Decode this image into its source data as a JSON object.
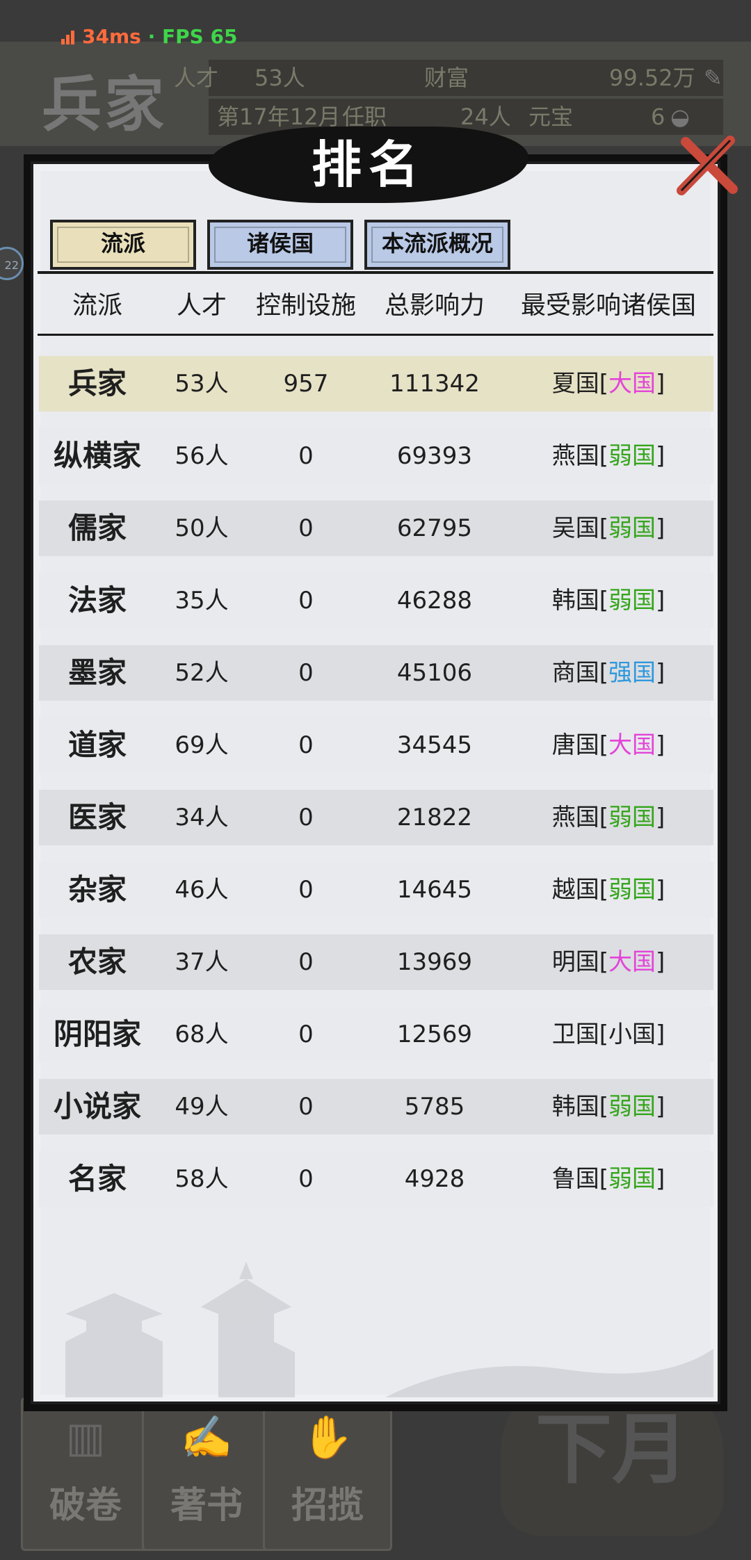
{
  "status": {
    "latency": "34ms",
    "separator": "·",
    "fps": "FPS 65"
  },
  "background": {
    "section_title": "兵家",
    "stats": {
      "talent_label": "人才",
      "talent_value": "53人",
      "wealth_label": "财富",
      "wealth_value": "99.52万",
      "date": "第17年12月",
      "office_label": "任职",
      "office_value": "24人",
      "ingot_label": "元宝",
      "ingot_value": "6"
    },
    "side_badge": "22",
    "bottom_buttons": [
      "破卷",
      "著书",
      "招揽"
    ],
    "next_month": "下月"
  },
  "modal": {
    "title": "排名",
    "tabs": [
      "流派",
      "诸侯国",
      "本流派概况"
    ],
    "columns": [
      "流派",
      "人才",
      "控制设施",
      "总影响力",
      "最受影响诸侯国"
    ],
    "rows": [
      {
        "school": "兵家",
        "talent": "53人",
        "control": "957",
        "influence": "111342",
        "state": "夏国",
        "tier": "大国",
        "tier_class": "tier-big"
      },
      {
        "school": "纵横家",
        "talent": "56人",
        "control": "0",
        "influence": "69393",
        "state": "燕国",
        "tier": "弱国",
        "tier_class": "tier-weak"
      },
      {
        "school": "儒家",
        "talent": "50人",
        "control": "0",
        "influence": "62795",
        "state": "吴国",
        "tier": "弱国",
        "tier_class": "tier-weak"
      },
      {
        "school": "法家",
        "talent": "35人",
        "control": "0",
        "influence": "46288",
        "state": "韩国",
        "tier": "弱国",
        "tier_class": "tier-weak"
      },
      {
        "school": "墨家",
        "talent": "52人",
        "control": "0",
        "influence": "45106",
        "state": "商国",
        "tier": "强国",
        "tier_class": "tier-strong"
      },
      {
        "school": "道家",
        "talent": "69人",
        "control": "0",
        "influence": "34545",
        "state": "唐国",
        "tier": "大国",
        "tier_class": "tier-big"
      },
      {
        "school": "医家",
        "talent": "34人",
        "control": "0",
        "influence": "21822",
        "state": "燕国",
        "tier": "弱国",
        "tier_class": "tier-weak"
      },
      {
        "school": "杂家",
        "talent": "46人",
        "control": "0",
        "influence": "14645",
        "state": "越国",
        "tier": "弱国",
        "tier_class": "tier-weak"
      },
      {
        "school": "农家",
        "talent": "37人",
        "control": "0",
        "influence": "13969",
        "state": "明国",
        "tier": "大国",
        "tier_class": "tier-big"
      },
      {
        "school": "阴阳家",
        "talent": "68人",
        "control": "0",
        "influence": "12569",
        "state": "卫国",
        "tier": "小国",
        "tier_class": "tier-small"
      },
      {
        "school": "小说家",
        "talent": "49人",
        "control": "0",
        "influence": "5785",
        "state": "韩国",
        "tier": "弱国",
        "tier_class": "tier-weak"
      },
      {
        "school": "名家",
        "talent": "58人",
        "control": "0",
        "influence": "4928",
        "state": "鲁国",
        "tier": "弱国",
        "tier_class": "tier-weak"
      }
    ]
  },
  "colors": {
    "big": "#e344d8",
    "weak": "#35a51c",
    "strong": "#2f98dd",
    "small": "#1f1f1f",
    "tab_active": "#e9e0bb",
    "tab_inactive": "#b9c9e6"
  },
  "icons": {
    "close": "close-icon",
    "signal": "signal-bars-icon",
    "money": "money-icon",
    "ingot": "ingot-icon"
  }
}
